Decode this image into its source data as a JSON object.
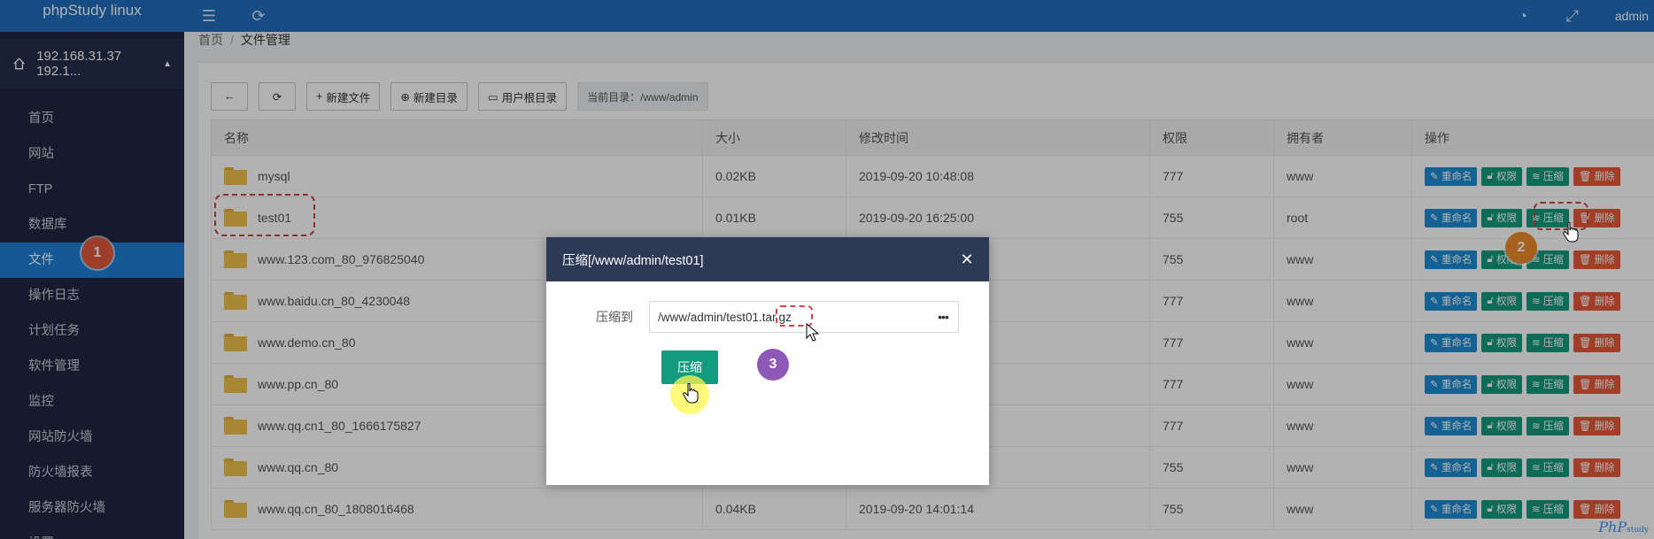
{
  "brand": "phpStudy linux",
  "server": "192.168.31.37 192.1...",
  "menu": [
    {
      "label": "首页"
    },
    {
      "label": "网站"
    },
    {
      "label": "FTP"
    },
    {
      "label": "数据库"
    },
    {
      "label": "文件"
    },
    {
      "label": "操作日志"
    },
    {
      "label": "计划任务"
    },
    {
      "label": "软件管理"
    },
    {
      "label": "监控"
    },
    {
      "label": "网站防火墙"
    },
    {
      "label": "防火墙报表"
    },
    {
      "label": "服务器防火墙"
    },
    {
      "label": "设置"
    }
  ],
  "topbar": {
    "user": "admin"
  },
  "breadcrumb": {
    "home": "首页",
    "current": "文件管理"
  },
  "toolbar": {
    "new_file": "新建文件",
    "new_dir": "新建目录",
    "user_root": "用户根目录",
    "current_dir": "当前目录：/www/admin"
  },
  "table": {
    "headers": [
      "名称",
      "大小",
      "修改时间",
      "权限",
      "拥有者",
      "操作"
    ],
    "rows": [
      {
        "name": "mysql",
        "size": "0.02KB",
        "time": "2019-09-20 10:48:08",
        "perm": "777",
        "owner": "www"
      },
      {
        "name": "test01",
        "size": "0.01KB",
        "time": "2019-09-20 16:25:00",
        "perm": "755",
        "owner": "root"
      },
      {
        "name": "www.123.com_80_976825040",
        "size": "",
        "time": "",
        "perm": "755",
        "owner": "www"
      },
      {
        "name": "www.baidu.cn_80_4230048",
        "size": "",
        "time": "",
        "perm": "777",
        "owner": "www"
      },
      {
        "name": "www.demo.cn_80",
        "size": "",
        "time": "",
        "perm": "777",
        "owner": "www"
      },
      {
        "name": "www.pp.cn_80",
        "size": "",
        "time": "",
        "perm": "777",
        "owner": "www"
      },
      {
        "name": "www.qq.cn1_80_1666175827",
        "size": "",
        "time": "",
        "perm": "777",
        "owner": "www"
      },
      {
        "name": "www.qq.cn_80",
        "size": "",
        "time": "",
        "perm": "755",
        "owner": "www"
      },
      {
        "name": "www.qq.cn_80_1808016468",
        "size": "0.04KB",
        "time": "2019-09-20 14:01:14",
        "perm": "755",
        "owner": "www"
      }
    ],
    "ops": {
      "rename": "重命名",
      "perm": "权限",
      "zip": "压缩",
      "del": "删除"
    }
  },
  "modal": {
    "title": "压缩[/www/admin/test01]",
    "label": "压缩到",
    "value": "/www/admin/test01.tar.gz",
    "submit": "压缩"
  },
  "annotations": {
    "step1": "1",
    "step2": "2",
    "step3": "3"
  },
  "logo": {
    "main": "PhP",
    "sub": "study"
  },
  "colors": {
    "sidebar": "#1f2740",
    "topbar": "#1f6fbd",
    "active": "#1e7fd6",
    "green": "#139b7f",
    "red": "#e65a3a",
    "blue": "#1e8bd4"
  }
}
